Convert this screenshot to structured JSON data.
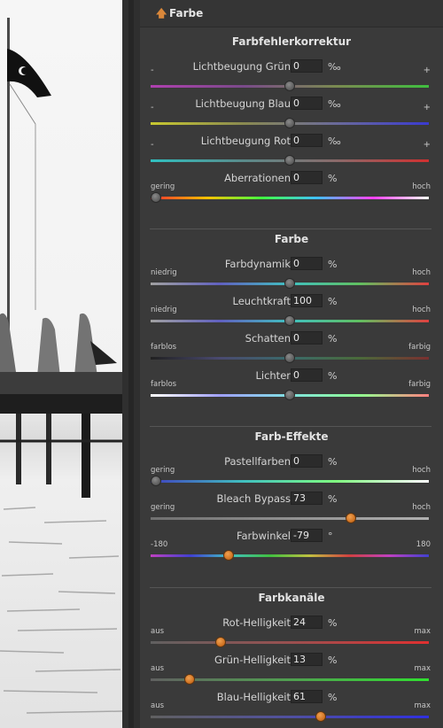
{
  "panel": {
    "title": "Farbe",
    "title_icon": "arrow-up-icon"
  },
  "sections": [
    {
      "title": "Farbfehlerkorrektur",
      "sliders": [
        {
          "label": "Lichtbeugung Grün",
          "value": "0",
          "unit": "‰",
          "min_label": "-",
          "max_label": "+",
          "position": 0.5,
          "thumb": "gray",
          "gradient": [
            "#b040b0",
            "#7a4a8a",
            "#7a8a50",
            "#3fbf3f"
          ]
        },
        {
          "label": "Lichtbeugung Blau",
          "value": "0",
          "unit": "‰",
          "min_label": "-",
          "max_label": "+",
          "position": 0.5,
          "thumb": "gray",
          "gradient": [
            "#c8c830",
            "#8a8a50",
            "#6a6a9a",
            "#3a3ad0"
          ]
        },
        {
          "label": "Lichtbeugung Rot",
          "value": "0",
          "unit": "‰",
          "min_label": "-",
          "max_label": "+",
          "position": 0.5,
          "thumb": "gray",
          "gradient": [
            "#30c0c0",
            "#5a8a8a",
            "#8a6a6a",
            "#d03030"
          ]
        },
        {
          "label": "Aberrationen",
          "value": "0",
          "unit": "%",
          "min_label": "gering",
          "max_label": "hoch",
          "position": 0.02,
          "thumb": "gray",
          "gradient": [
            "#ff3030",
            "#ffc000",
            "#40ff40",
            "#40c0ff",
            "#ff40ff",
            "#ffffff"
          ]
        }
      ]
    },
    {
      "title": "Farbe",
      "sliders": [
        {
          "label": "Farbdynamik",
          "value": "0",
          "unit": "%",
          "min_label": "niedrig",
          "max_label": "hoch",
          "position": 0.5,
          "thumb": "gray",
          "gradient": [
            "#a0a0a0",
            "#6060c0",
            "#40c0c0",
            "#60c060",
            "#e04040"
          ]
        },
        {
          "label": "Leuchtkraft",
          "value": "100",
          "unit": "%",
          "min_label": "niedrig",
          "max_label": "hoch",
          "position": 0.5,
          "thumb": "gray",
          "gradient": [
            "#a0a0a0",
            "#6060c0",
            "#40c0c0",
            "#60c060",
            "#e04040"
          ]
        },
        {
          "label": "Schatten",
          "value": "0",
          "unit": "%",
          "min_label": "farblos",
          "max_label": "farbig",
          "position": 0.5,
          "thumb": "gray",
          "gradient": [
            "#202020",
            "#4a4a70",
            "#3a6a6a",
            "#4a6a3a",
            "#7a3030"
          ]
        },
        {
          "label": "Lichter",
          "value": "0",
          "unit": "%",
          "min_label": "farblos",
          "max_label": "farbig",
          "position": 0.5,
          "thumb": "gray",
          "gradient": [
            "#ffffff",
            "#a0a0ff",
            "#80e0e0",
            "#90ff90",
            "#ff8080"
          ]
        }
      ]
    },
    {
      "title": "Farb-Effekte",
      "sliders": [
        {
          "label": "Pastellfarben",
          "value": "0",
          "unit": "%",
          "min_label": "gering",
          "max_label": "hoch",
          "position": 0.02,
          "thumb": "gray",
          "gradient": [
            "#4040c0",
            "#40c0c0",
            "#80ff80",
            "#ffffff"
          ]
        },
        {
          "label": "Bleach Bypass",
          "value": "73",
          "unit": "%",
          "min_label": "gering",
          "max_label": "hoch",
          "position": 0.72,
          "thumb": "orange",
          "gradient": [
            "#707070",
            "#909090",
            "#b0b0b0"
          ]
        },
        {
          "label": "Farbwinkel",
          "value": "-79",
          "unit": "°",
          "min_label": "-180",
          "max_label": "180",
          "position": 0.28,
          "thumb": "orange",
          "gradient": [
            "#c040c0",
            "#4040d0",
            "#40c0c0",
            "#40c040",
            "#c0c040",
            "#d04040",
            "#c040c0",
            "#4040d0"
          ]
        }
      ]
    },
    {
      "title": "Farbkanäle",
      "sliders": [
        {
          "label": "Rot-Helligkeit",
          "value": "24",
          "unit": "%",
          "min_label": "aus",
          "max_label": "max",
          "position": 0.25,
          "thumb": "orange",
          "gradient": [
            "#606060",
            "#9a5050",
            "#e03030"
          ]
        },
        {
          "label": "Grün-Helligkeit",
          "value": "13",
          "unit": "%",
          "min_label": "aus",
          "max_label": "max",
          "position": 0.14,
          "thumb": "orange",
          "gradient": [
            "#606060",
            "#50a050",
            "#30e030"
          ]
        },
        {
          "label": "Blau-Helligkeit",
          "value": "61",
          "unit": "%",
          "min_label": "aus",
          "max_label": "max",
          "position": 0.61,
          "thumb": "orange",
          "gradient": [
            "#606060",
            "#5050a0",
            "#3030e0"
          ]
        }
      ]
    }
  ]
}
